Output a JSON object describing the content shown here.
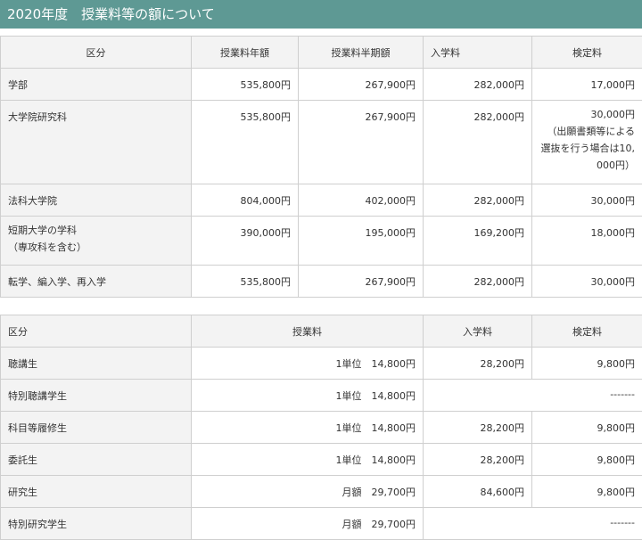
{
  "header": {
    "title": "2020年度　授業料等の額について"
  },
  "table1": {
    "headers": [
      "区分",
      "授業料年額",
      "授業料半期額",
      "入学料",
      "検定料"
    ],
    "rows": [
      {
        "label": "学部",
        "c1": "535,800円",
        "c2": "267,900円",
        "c3": "282,000円",
        "c4": "17,000円"
      },
      {
        "label": "大学院研究科",
        "c1": "535,800円",
        "c2": "267,900円",
        "c3": "282,000円",
        "c4": "30,000円\n（出願書類等による選抜を行う場合は10,000円）"
      },
      {
        "label": "法科大学院",
        "c1": "804,000円",
        "c2": "402,000円",
        "c3": "282,000円",
        "c4": "30,000円"
      },
      {
        "label": "短期大学の学科\n（専攻科を含む）",
        "c1": "390,000円",
        "c2": "195,000円",
        "c3": "169,200円",
        "c4": "18,000円"
      },
      {
        "label": "転学、編入学、再入学",
        "c1": "535,800円",
        "c2": "267,900円",
        "c3": "282,000円",
        "c4": "30,000円"
      }
    ]
  },
  "table2": {
    "headers": [
      "区分",
      "授業料",
      "入学料",
      "検定料"
    ],
    "rows": [
      {
        "label": "聴講生",
        "fee": "1単位　14,800円",
        "entrance": "28,200円",
        "exam": "9,800円"
      },
      {
        "label": "特別聴講学生",
        "fee": "1単位　14,800円",
        "merged": "-------"
      },
      {
        "label": "科目等履修生",
        "fee": "1単位　14,800円",
        "entrance": "28,200円",
        "exam": "9,800円"
      },
      {
        "label": "委託生",
        "fee": "1単位　14,800円",
        "entrance": "28,200円",
        "exam": "9,800円"
      },
      {
        "label": "研究生",
        "fee": "月額　29,700円",
        "entrance": "84,600円",
        "exam": "9,800円"
      },
      {
        "label": "特別研究学生",
        "fee": "月額　29,700円",
        "merged": "-------"
      }
    ]
  }
}
